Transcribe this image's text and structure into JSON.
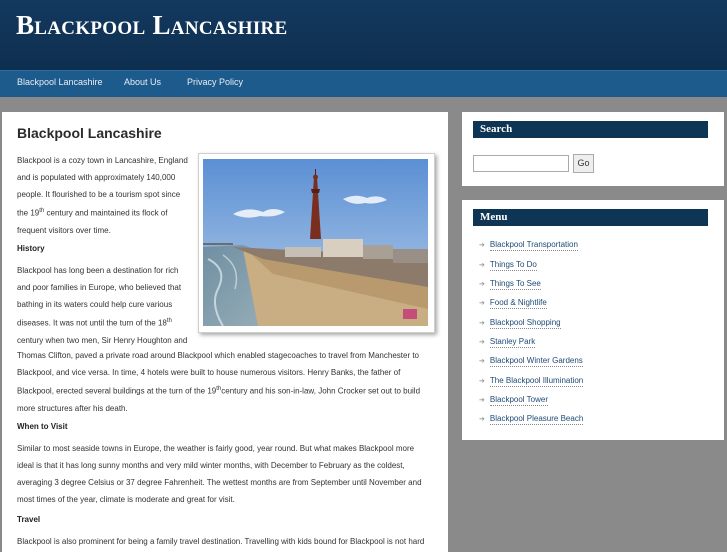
{
  "site": {
    "title": "Blackpool Lancashire"
  },
  "nav": {
    "items": [
      "Blackpool Lancashire",
      "About Us",
      "Privacy Policy"
    ]
  },
  "article": {
    "heading": "Blackpool Lancashire",
    "intro": {
      "lines": [
        "Blackpool is a cozy town in Lancashire, England",
        "and is populated with approximately 140,000",
        "people. It flourished to be a tourism spot since",
        "century and maintained its flock of",
        "frequent visitors over time."
      ],
      "ordinal_number": "19",
      "ordinal_suffix": "th",
      "ordinal_lead": "the"
    },
    "history": {
      "heading": "History",
      "lines": [
        "Blackpool has long been a destination for rich",
        "and poor families in Europe, who believed that",
        "bathing in its waters could help cure various",
        "diseases. It was not until the turn of the 18",
        "century when two men, Sir Henry Houghton and",
        "Thomas Clifton, paved a private road around Blackpool which enabled stagecoaches to travel from Manchester to",
        "Blackpool, and vice versa. In time, 4 hotels were built to house numerous visitors. Henry Banks, the father of",
        "Blackpool, erected several buildings at the turn of the 19",
        "century and his son-in-law, John Crocker set out to build",
        "more structures after his death."
      ],
      "sup": "th"
    },
    "when_to_visit": {
      "heading": "When to Visit",
      "lines": [
        "Similar to most seaside towns in Europe, the weather is fairly good, year round. But what makes Blackpool more",
        "ideal is that it has long sunny months and very mild winter months, with December to February as the coldest,",
        "averaging 3 degree Celsius or 37 degree Fahrenheit. The wettest months are from September until November and",
        "most times of the year, climate is moderate and great for visit."
      ]
    },
    "travel": {
      "heading": "Travel",
      "lines": [
        "Blackpool is also prominent for being a family travel destination. Travelling with kids bound for Blackpool is not hard"
      ]
    }
  },
  "sidebar": {
    "search": {
      "heading": "Search",
      "button": "Go",
      "value": ""
    },
    "menu": {
      "heading": "Menu",
      "items": [
        "Blackpool Transportation",
        "Things To Do",
        "Things To See",
        "Food & Nightlife",
        "Blackpool Shopping",
        "Stanley Park",
        "Blackpool Winter Gardens",
        "The Blackpool Illumination",
        "Blackpool Tower",
        "Blackpool Pleasure Beach"
      ]
    }
  },
  "colors": {
    "header": "#13395f",
    "nav": "#1d5b8d",
    "panel_head": "#0f3555",
    "link": "#1d4a75"
  }
}
